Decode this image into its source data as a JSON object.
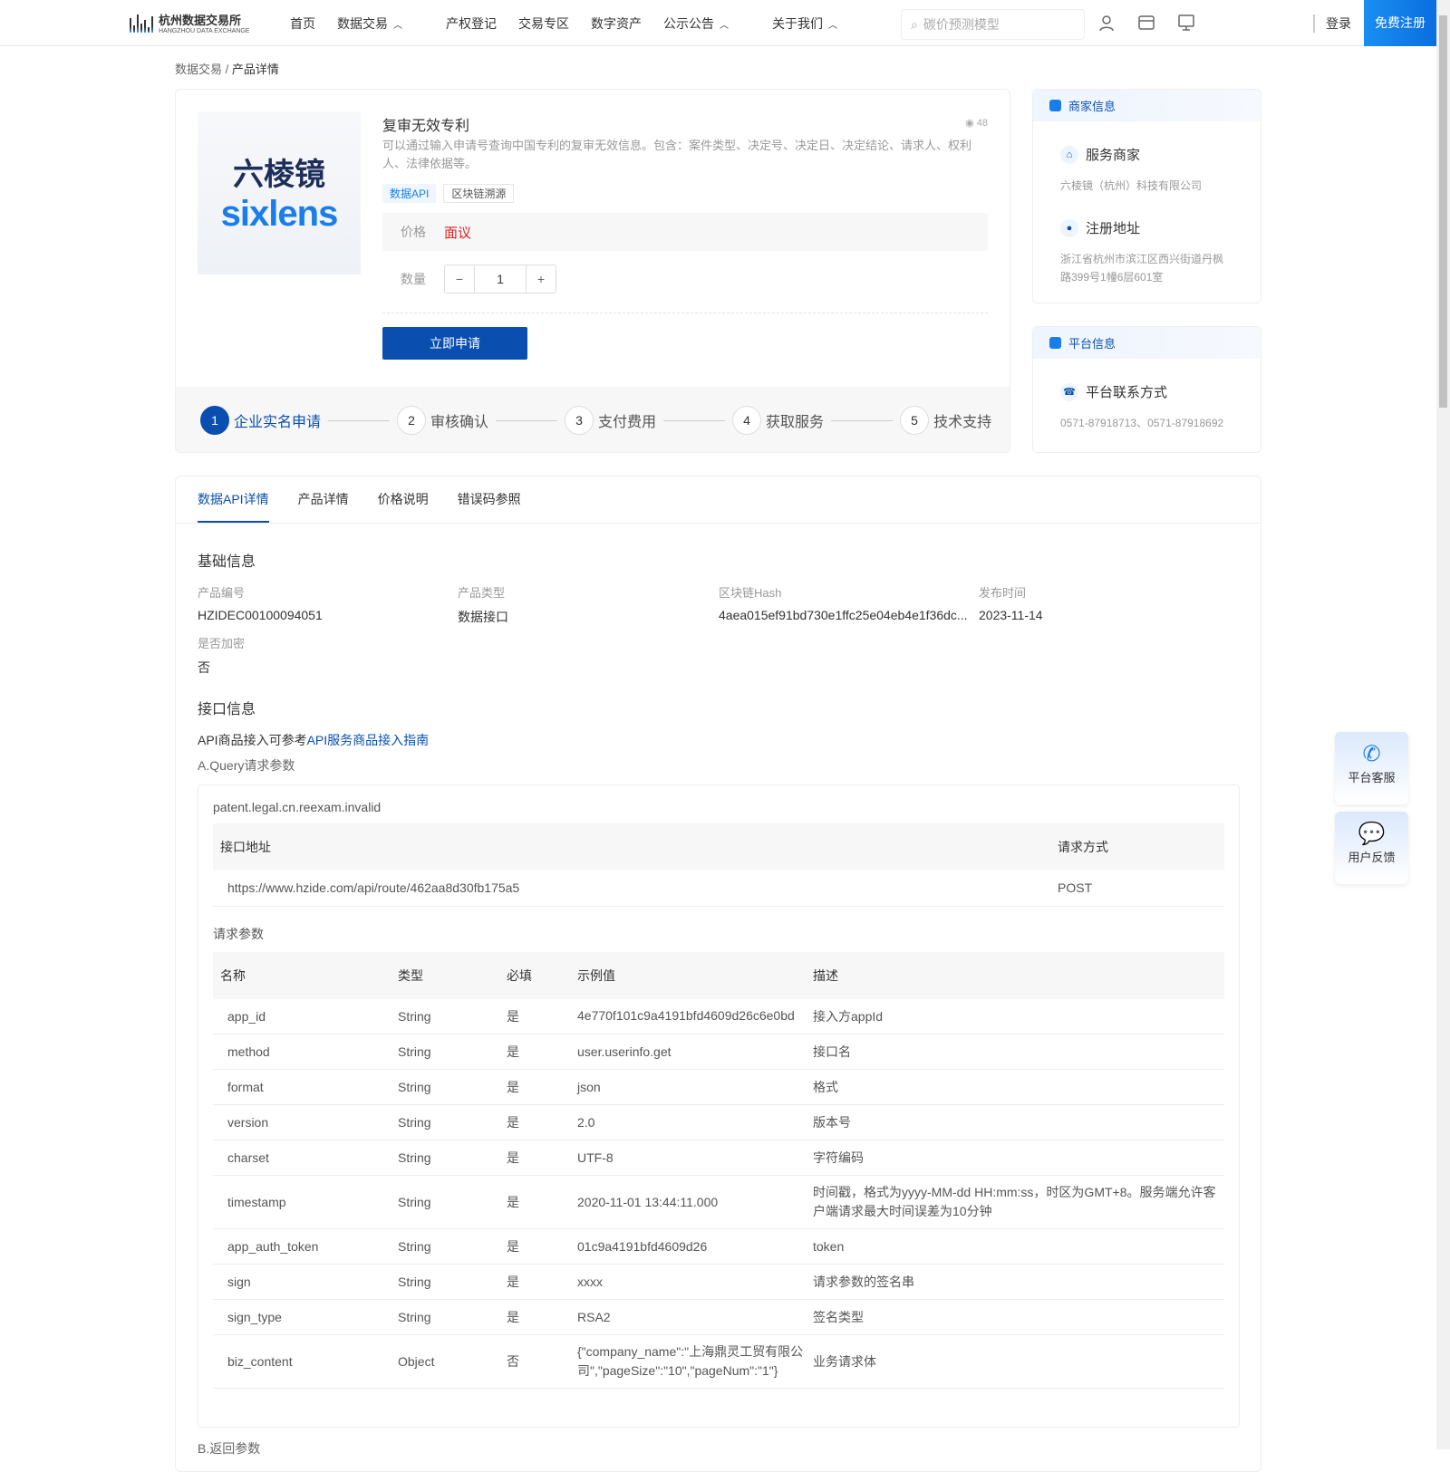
{
  "header": {
    "logo_cn": "杭州数据交易所",
    "logo_en": "HANGZHOU DATA EXCHANGE",
    "nav": [
      {
        "label": "首页",
        "caret": false
      },
      {
        "label": "数据交易",
        "caret": true
      },
      {
        "label": "产权登记",
        "caret": false
      },
      {
        "label": "交易专区",
        "caret": false
      },
      {
        "label": "数字资产",
        "caret": false
      },
      {
        "label": "公示公告",
        "caret": true
      },
      {
        "label": "关于我们",
        "caret": true
      }
    ],
    "search_placeholder": "碳价预测模型",
    "login": "登录",
    "register": "免费注册"
  },
  "breadcrumb": {
    "parent": "数据交易",
    "sep": "/",
    "current": "产品详情"
  },
  "product": {
    "logo_cn": "六棱镜",
    "logo_en": "sixlens",
    "title": "复审无效专利",
    "views": "48",
    "description": "可以通过输入申请号查询中国专利的复审无效信息。包含：案件类型、决定号、决定日、决定结论、请求人、权利人、法律依据等。",
    "tags": [
      "数据API",
      "区块链溯源"
    ],
    "price_label": "价格",
    "price": "面议",
    "qty_label": "数量",
    "qty": "1",
    "apply": "立即申请",
    "steps": [
      {
        "n": "1",
        "label": "企业实名申请"
      },
      {
        "n": "2",
        "label": "审核确认"
      },
      {
        "n": "3",
        "label": "支付费用"
      },
      {
        "n": "4",
        "label": "获取服务"
      },
      {
        "n": "5",
        "label": "技术支持"
      }
    ]
  },
  "merchant": {
    "title": "商家信息",
    "service_label": "服务商家",
    "service": "六棱镜（杭州）科技有限公司",
    "addr_label": "注册地址",
    "addr": "浙江省杭州市滨江区西兴街道丹枫路399号1幢6层601室"
  },
  "platform": {
    "title": "平台信息",
    "contact_label": "平台联系方式",
    "contact": "0571-87918713、0571-87918692"
  },
  "tabs": [
    "数据API详情",
    "产品详情",
    "价格说明",
    "错误码参照"
  ],
  "basic": {
    "title": "基础信息",
    "fields": [
      {
        "k": "产品编号",
        "v": "HZIDEC00100094051"
      },
      {
        "k": "产品类型",
        "v": "数据接口"
      },
      {
        "k": "区块链Hash",
        "v": "4aea015ef91bd730e1ffc25e04eb4e1f36dc..."
      },
      {
        "k": "发布时间",
        "v": "2023-11-14"
      },
      {
        "k": "是否加密",
        "v": "否"
      }
    ]
  },
  "api": {
    "title": "接口信息",
    "guide_prefix": "API商品接入可参考",
    "guide_link": "API服务商品接入指南",
    "query_title": "A.Query请求参数",
    "method_name": "patent.legal.cn.reexam.invalid",
    "addr_header": "接口地址",
    "method_header": "请求方式",
    "url": "https://www.hzide.com/api/route/462aa8d30fb175a5",
    "http_method": "POST",
    "params_title": "请求参数",
    "param_headers": [
      "名称",
      "类型",
      "必填",
      "示例值",
      "描述"
    ],
    "params": [
      [
        "app_id",
        "String",
        "是",
        "4e770f101c9a4191bfd4609d26c6e0bd",
        "接入方appId"
      ],
      [
        "method",
        "String",
        "是",
        "user.userinfo.get",
        "接口名"
      ],
      [
        "format",
        "String",
        "是",
        "json",
        "格式"
      ],
      [
        "version",
        "String",
        "是",
        "2.0",
        "版本号"
      ],
      [
        "charset",
        "String",
        "是",
        "UTF-8",
        "字符编码"
      ],
      [
        "timestamp",
        "String",
        "是",
        "2020-11-01 13:44:11.000",
        "时间戳，格式为yyyy-MM-dd HH:mm:ss，时区为GMT+8。服务端允许客户端请求最大时间误差为10分钟"
      ],
      [
        "app_auth_token",
        "String",
        "是",
        "01c9a4191bfd4609d26",
        "token"
      ],
      [
        "sign",
        "String",
        "是",
        "xxxx",
        "请求参数的签名串"
      ],
      [
        "sign_type",
        "String",
        "是",
        "RSA2",
        "签名类型"
      ],
      [
        "biz_content",
        "Object",
        "否",
        "{\"company_name\":\"上海鼎灵工贸有限公司\",\"pageSize\":\"10\",\"pageNum\":\"1\"}",
        "业务请求体"
      ]
    ],
    "return_title": "B.返回参数"
  },
  "float": {
    "service": "平台客服",
    "feedback": "用户反馈"
  }
}
